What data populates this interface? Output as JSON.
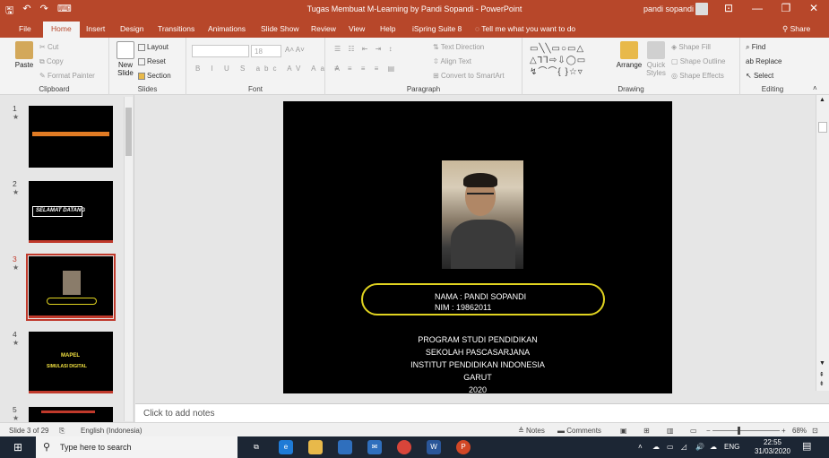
{
  "window": {
    "title": "Tugas Membuat M-Learning by Pandi Sopandi - PowerPoint",
    "user": "pandi sopandi",
    "qa_save": "🖫",
    "qa_undo": "↶",
    "qa_redo": "↷",
    "qa_custom": "⌨",
    "minimize": "—",
    "restore": "❐",
    "close": "✕",
    "ribbon_opts": "⊡"
  },
  "tabs": [
    "File",
    "Home",
    "Insert",
    "Design",
    "Transitions",
    "Animations",
    "Slide Show",
    "Review",
    "View",
    "Help",
    "iSpring Suite 8"
  ],
  "tellme": "Tell me what you want to do",
  "share": "Share",
  "ribbon": {
    "clipboard": {
      "label": "Clipboard",
      "paste": "Paste",
      "cut": "Cut",
      "copy": "Copy",
      "format_painter": "Format Painter"
    },
    "slides": {
      "label": "Slides",
      "new_slide": "New Slide",
      "layout": "Layout",
      "reset": "Reset",
      "section": "Section"
    },
    "font": {
      "label": "Font",
      "size": "18"
    },
    "paragraph": {
      "label": "Paragraph",
      "text_direction": "Text Direction",
      "align_text": "Align Text",
      "convert": "Convert to SmartArt"
    },
    "drawing": {
      "label": "Drawing",
      "arrange": "Arrange",
      "quick_styles": "Quick Styles",
      "shape_fill": "Shape Fill",
      "shape_outline": "Shape Outline",
      "shape_effects": "Shape Effects"
    },
    "editing": {
      "label": "Editing",
      "find": "Find",
      "replace": "Replace",
      "select": "Select"
    }
  },
  "thumbnails": [
    {
      "num": "1",
      "star": "★"
    },
    {
      "num": "2",
      "star": "★",
      "title": "SELAMAT DATANG"
    },
    {
      "num": "3",
      "star": "★"
    },
    {
      "num": "4",
      "star": "★",
      "title": "MAPEL",
      "subtitle": "SIMULASI DIGITAL"
    },
    {
      "num": "5",
      "star": "★"
    }
  ],
  "slide": {
    "name_line": "NAMA  : PANDI SOPANDI",
    "nim_line": "NIM      : 19862011",
    "program": [
      "PROGRAM STUDI PENDIDIKAN",
      "SEKOLAH PASCASARJANA",
      "INSTITUT PENDIDIKAN INDONESIA",
      "GARUT",
      "2020"
    ]
  },
  "notes_placeholder": "Click to add notes",
  "status": {
    "slide_of": "Slide 3 of 29",
    "language": "English (Indonesia)",
    "notes": "Notes",
    "comments": "Comments",
    "zoom": "68%"
  },
  "taskbar": {
    "search_placeholder": "Type here to search",
    "time": "22:55",
    "date": "31/03/2020",
    "lang": "ENG"
  },
  "colors": {
    "accent": "#b7472a",
    "slide_bg": "#000000",
    "highlight": "#e0d320"
  }
}
